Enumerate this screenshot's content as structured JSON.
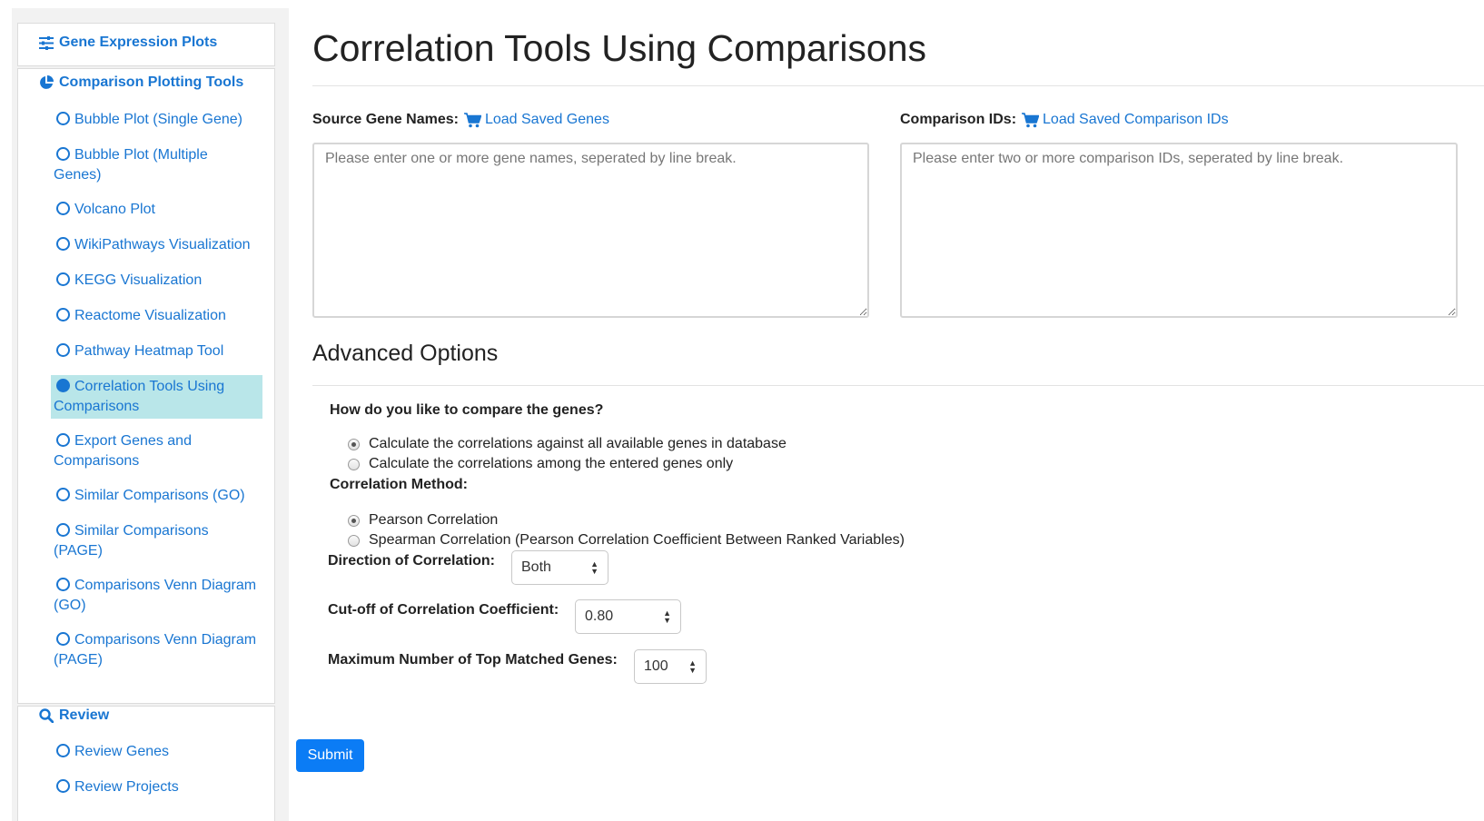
{
  "sidebar": {
    "expression_title": "Gene Expression Plots",
    "comparison_title": "Comparison Plotting Tools",
    "items": [
      {
        "label": "Bubble Plot (Single Gene)"
      },
      {
        "label": "Bubble Plot (Multiple Genes)"
      },
      {
        "label": "Volcano Plot"
      },
      {
        "label": "WikiPathways Visualization"
      },
      {
        "label": "KEGG Visualization"
      },
      {
        "label": "Reactome Visualization"
      },
      {
        "label": "Pathway Heatmap Tool"
      },
      {
        "label": "Correlation Tools Using Comparisons"
      },
      {
        "label": "Export Genes and Comparisons"
      },
      {
        "label": "Similar Comparisons (GO)"
      },
      {
        "label": "Similar Comparisons (PAGE)"
      },
      {
        "label": "Comparisons Venn Diagram (GO)"
      },
      {
        "label": "Comparisons Venn Diagram (PAGE)"
      }
    ],
    "active_index": 7,
    "review_title": "Review",
    "review_items": [
      {
        "label": "Review Genes"
      },
      {
        "label": "Review Projects"
      }
    ]
  },
  "main": {
    "title": "Correlation Tools Using Comparisons",
    "source_genes": {
      "label": "Source Gene Names:",
      "link": "Load Saved Genes",
      "placeholder": "Please enter one or more gene names, seperated by line break.",
      "value": ""
    },
    "comparison_ids": {
      "label": "Comparison IDs:",
      "link": "Load Saved Comparison IDs",
      "placeholder": "Please enter two or more comparison IDs, seperated by line break.",
      "value": ""
    },
    "advanced_title": "Advanced Options",
    "compare_question": "How do you like to compare the genes?",
    "compare_options": [
      {
        "label": "Calculate the correlations against all available genes in database",
        "checked": true
      },
      {
        "label": "Calculate the correlations among the entered genes only",
        "checked": false
      }
    ],
    "method_label": "Correlation Method:",
    "method_options": [
      {
        "label": "Pearson Correlation",
        "checked": true
      },
      {
        "label": "Spearman Correlation (Pearson Correlation Coefficient Between Ranked Variables)",
        "checked": false
      }
    ],
    "direction_label": "Direction of Correlation:",
    "direction_value": "Both",
    "cutoff_label": "Cut-off of Correlation Coefficient:",
    "cutoff_value": "0.80",
    "max_label": "Maximum Number of Top Matched Genes:",
    "max_value": "100",
    "submit_label": "Submit"
  }
}
